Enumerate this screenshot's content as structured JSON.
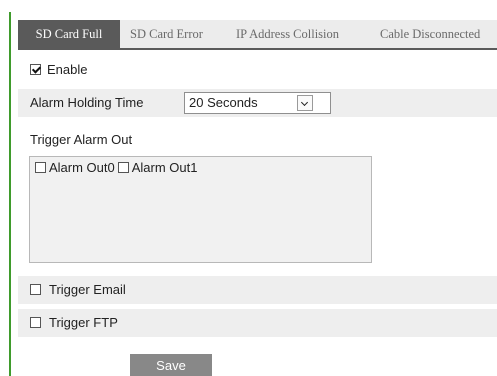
{
  "tabs": [
    {
      "label": "SD Card Full",
      "active": true
    },
    {
      "label": "SD Card Error",
      "active": false
    },
    {
      "label": "IP Address Collision",
      "active": false
    },
    {
      "label": "Cable Disconnected",
      "active": false
    }
  ],
  "enable": {
    "label": "Enable",
    "checked": true
  },
  "alarm_holding_time": {
    "label": "Alarm Holding Time",
    "value": "20 Seconds"
  },
  "trigger_alarm_out": {
    "label": "Trigger Alarm Out",
    "items": [
      {
        "label": "Alarm Out0",
        "checked": false
      },
      {
        "label": "Alarm Out1",
        "checked": false
      }
    ]
  },
  "trigger_email": {
    "label": "Trigger Email",
    "checked": false
  },
  "trigger_ftp": {
    "label": "Trigger FTP",
    "checked": false
  },
  "save_label": "Save",
  "colors": {
    "frame_edge": "#3f9b2c",
    "tab_active_bg": "#5a5a5a",
    "tab_bar_bg": "#ececec",
    "row_shade": "#eeeeee",
    "button_bg": "#888888"
  }
}
